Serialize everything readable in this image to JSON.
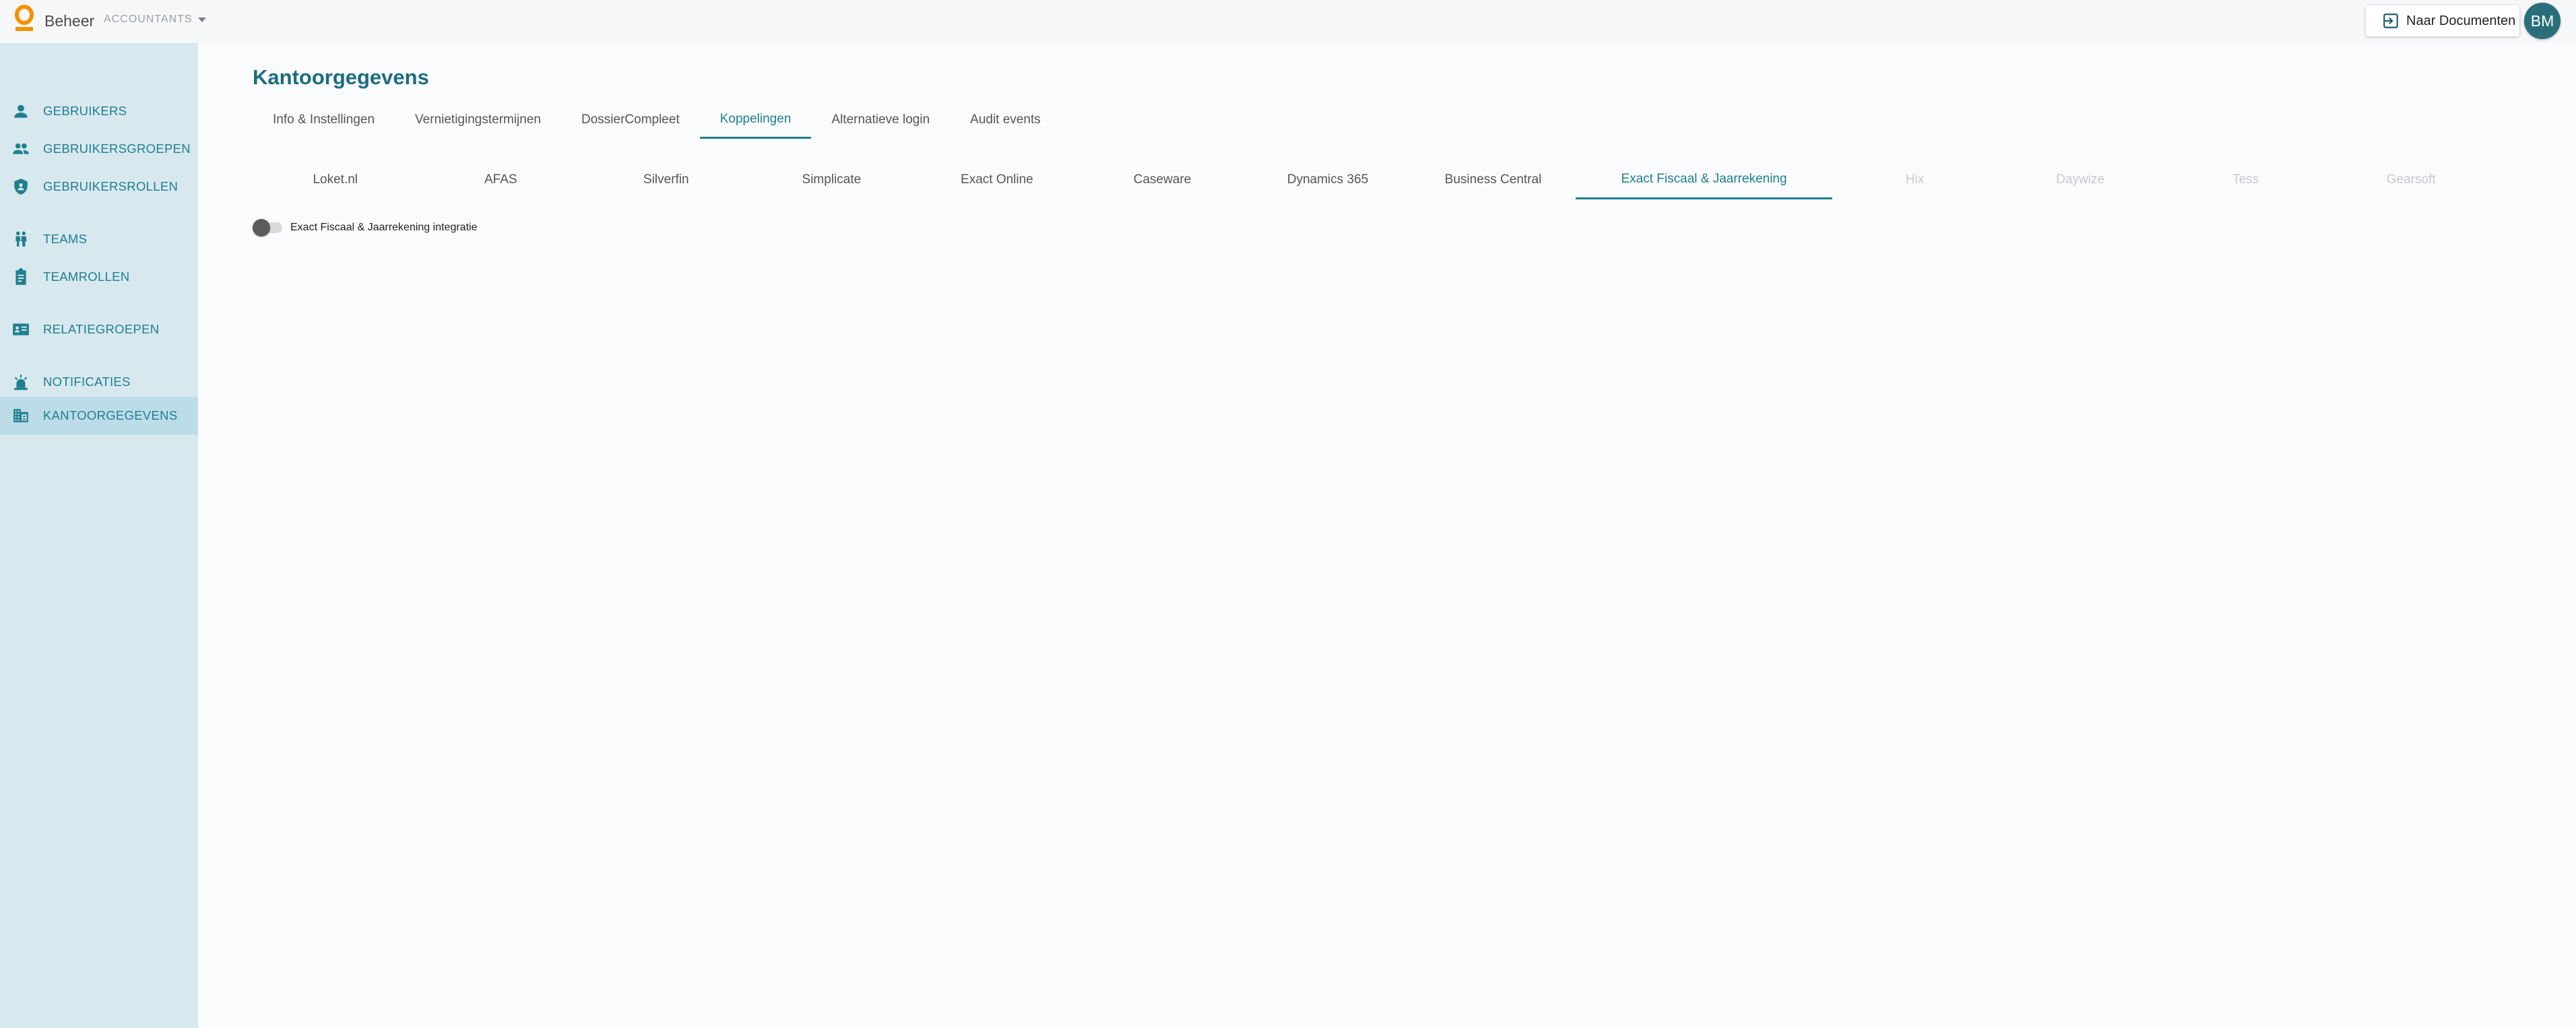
{
  "header": {
    "app_name": "Beheer",
    "context": "ACCOUNTANTS",
    "docs_button": "Naar Documenten",
    "avatar_initials": "BM"
  },
  "sidebar": {
    "items": [
      {
        "label": "GEBRUIKERS",
        "icon": "person-icon"
      },
      {
        "label": "GEBRUIKERSGROEPEN",
        "icon": "group-icon"
      },
      {
        "label": "GEBRUIKERSROLLEN",
        "icon": "shield-icon"
      },
      {
        "label": "TEAMS",
        "icon": "team-icon"
      },
      {
        "label": "TEAMROLLEN",
        "icon": "clipboard-icon"
      },
      {
        "label": "RELATIEGROEPEN",
        "icon": "contact-card-icon"
      },
      {
        "label": "NOTIFICATIES",
        "icon": "alarm-icon"
      },
      {
        "label": "KANTOORGEGEVENS",
        "icon": "building-icon",
        "active": true
      }
    ]
  },
  "main": {
    "title": "Kantoorgegevens",
    "tabs": [
      {
        "label": "Info & Instellingen"
      },
      {
        "label": "Vernietigingstermijnen"
      },
      {
        "label": "DossierCompleet"
      },
      {
        "label": "Koppelingen",
        "active": true
      },
      {
        "label": "Alternatieve login"
      },
      {
        "label": "Audit events"
      }
    ],
    "subtabs": [
      {
        "label": "Loket.nl"
      },
      {
        "label": "AFAS"
      },
      {
        "label": "Silverfin"
      },
      {
        "label": "Simplicate"
      },
      {
        "label": "Exact Online"
      },
      {
        "label": "Caseware"
      },
      {
        "label": "Dynamics 365"
      },
      {
        "label": "Business Central"
      },
      {
        "label": "Exact Fiscaal & Jaarrekening",
        "active": true
      },
      {
        "label": "Hix",
        "disabled": true
      },
      {
        "label": "Daywize",
        "disabled": true
      },
      {
        "label": "Tess",
        "disabled": true
      },
      {
        "label": "Gearsoft",
        "disabled": true
      }
    ],
    "toggle": {
      "label": "Exact Fiscaal & Jaarrekening integratie",
      "checked": false
    }
  },
  "colors": {
    "accent": "#1f7f8e",
    "logo": "#f39200",
    "sidebar_bg": "#d7e8ef",
    "avatar": "#2a6e7a"
  }
}
